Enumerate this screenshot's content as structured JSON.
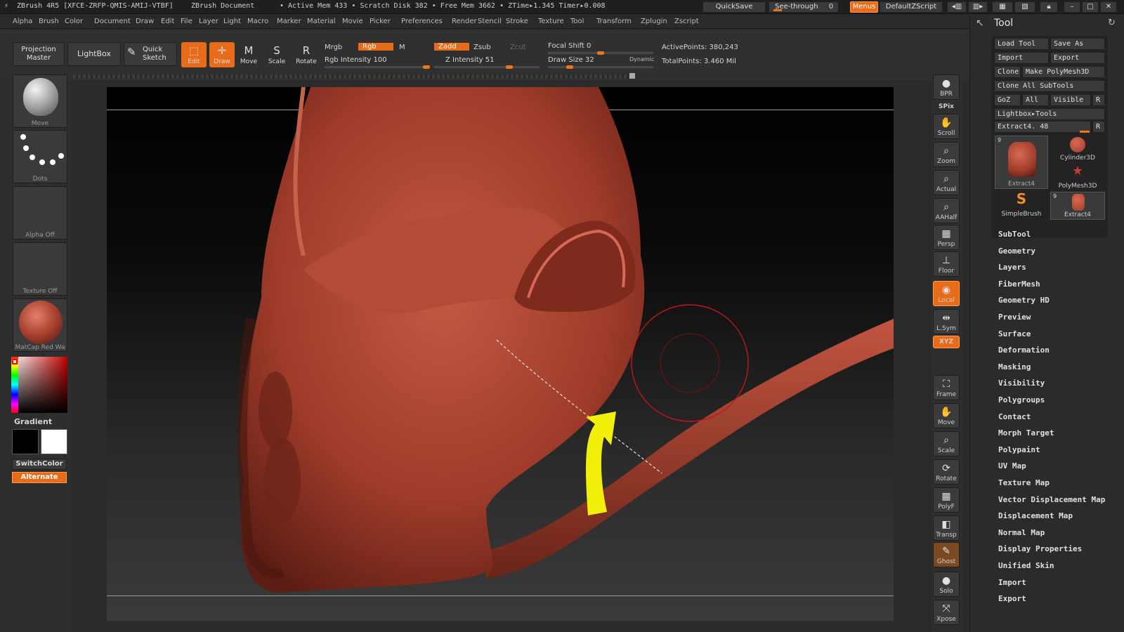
{
  "title": {
    "app": "ZBrush 4R5 [XFCE-ZRFP-QMIS-AMIJ-VTBF]",
    "doc": "ZBrush Document",
    "stats": "• Active Mem 433 • Scratch Disk 382 • Free Mem 3662 • ZTime▸1.345 Timer▸0.008",
    "quicksave": "QuickSave",
    "seethrough": "See-through",
    "seethrough_val": "0",
    "menus": "Menus",
    "script": "DefaultZScript"
  },
  "menubar": [
    "Alpha",
    "Brush",
    "Color",
    "Document",
    "Draw",
    "Edit",
    "File",
    "Layer",
    "Light",
    "Macro",
    "Marker",
    "Material",
    "Movie",
    "Picker",
    "Preferences",
    "Render",
    "Stencil",
    "Stroke",
    "Texture",
    "Tool",
    "Transform",
    "Zplugin",
    "Zscript"
  ],
  "shelf": {
    "projection_master": "Projection Master",
    "lightbox": "LightBox",
    "quick_sketch": "Quick Sketch",
    "edit": "Edit",
    "draw": "Draw",
    "move": "Move",
    "scale": "Scale",
    "rotate": "Rotate",
    "mrgb": "Mrgb",
    "rgb": "Rgb",
    "m": "M",
    "zadd": "Zadd",
    "zsub": "Zsub",
    "zcut": "Zcut",
    "rgb_intensity": "Rgb Intensity 100",
    "z_intensity": "Z Intensity 51",
    "focal_shift": "Focal Shift 0",
    "draw_size": "Draw Size 32",
    "dynamic": "Dynamic",
    "active_points": "ActivePoints: 380,243",
    "total_points": "TotalPoints: 3.460 Mil"
  },
  "left": {
    "brush": "Move",
    "stroke": "Dots",
    "alpha": "Alpha Off",
    "texture": "Texture Off",
    "material": "MatCap Red Wa",
    "gradient": "Gradient",
    "switchcolor": "SwitchColor",
    "alternate": "Alternate"
  },
  "right_strip": [
    {
      "icon": "bpr-icon",
      "label": "BPR"
    },
    {
      "icon": "spix-icon",
      "label": "SPix"
    },
    {
      "icon": "scroll-icon",
      "label": "Scroll"
    },
    {
      "icon": "zoom-icon",
      "label": "Zoom"
    },
    {
      "icon": "actual-icon",
      "label": "Actual"
    },
    {
      "icon": "aahalf-icon",
      "label": "AAHalf"
    },
    {
      "icon": "persp-icon",
      "label": "Persp"
    },
    {
      "icon": "floor-icon",
      "label": "Floor"
    },
    {
      "icon": "local-icon",
      "label": "Local"
    },
    {
      "icon": "lsym-icon",
      "label": "L.Sym"
    },
    {
      "icon": "xyz-icon",
      "label": "XYZ"
    },
    {
      "icon": "frame-icon",
      "label": "Frame"
    },
    {
      "icon": "move-icon",
      "label": "Move"
    },
    {
      "icon": "scale-icon",
      "label": "Scale"
    },
    {
      "icon": "rotate-icon",
      "label": "Rotate"
    },
    {
      "icon": "polyf-icon",
      "label": "PolyF"
    },
    {
      "icon": "transp-icon",
      "label": "Transp"
    },
    {
      "icon": "ghost-icon",
      "label": "Ghost"
    },
    {
      "icon": "solo-icon",
      "label": "Solo"
    },
    {
      "icon": "xpose-icon",
      "label": "Xpose"
    }
  ],
  "tool": {
    "header": "Tool",
    "load_tool": "Load Tool",
    "save_as": "Save As",
    "import": "Import",
    "export": "Export",
    "clone": "Clone",
    "make_polymesh": "Make PolyMesh3D",
    "clone_all": "Clone All SubTools",
    "goz": "GoZ",
    "all": "All",
    "visible": "Visible",
    "r": "R",
    "lightbox_tools": "Lightbox▸Tools",
    "current": "Extract4. 48",
    "thumbs": [
      {
        "label": "Extract4",
        "badge": "9"
      },
      {
        "label": "Cylinder3D",
        "badge": ""
      },
      {
        "label": "PolyMesh3D",
        "badge": ""
      },
      {
        "label": "SimpleBrush",
        "badge": ""
      },
      {
        "label": "Extract4",
        "badge": "9"
      }
    ],
    "menu": [
      "SubTool",
      "Geometry",
      "Layers",
      "FiberMesh",
      "Geometry HD",
      "Preview",
      "Surface",
      "Deformation",
      "Masking",
      "Visibility",
      "Polygroups",
      "Contact",
      "Morph Target",
      "Polypaint",
      "UV Map",
      "Texture Map",
      "Vector Displacement Map",
      "Displacement Map",
      "Normal Map",
      "Display Properties",
      "Unified Skin",
      "Import",
      "Export"
    ]
  },
  "colors": {
    "accent": "#e86b1a",
    "clay": "#a8412f",
    "arrow": "#f2ef0a",
    "cursor": "#c01818"
  }
}
